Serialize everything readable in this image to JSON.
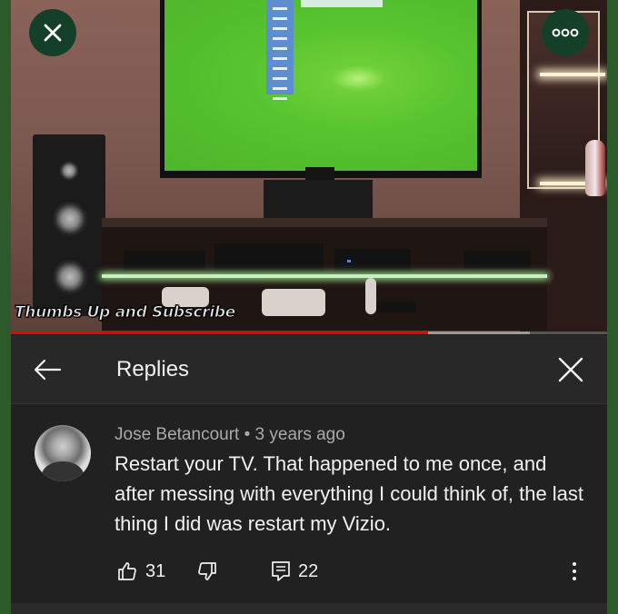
{
  "video": {
    "caption": "Thumbs Up and Subscribe",
    "progress_percent": 70,
    "buffer_percent": 87
  },
  "header": {
    "title": "Replies"
  },
  "comment": {
    "author": "Jose Betancourt",
    "separator": "•",
    "age": "3 years ago",
    "text": "Restart your TV. That happened to me once, and after messing with everything I could think of, the last thing I did was restart my Vizio.",
    "likes": "31",
    "replies": "22"
  },
  "icons": {
    "close_video": "close-icon",
    "more": "more-dots-icon",
    "back": "arrow-left-icon",
    "close_panel": "close-icon",
    "like": "thumbs-up-icon",
    "dislike": "thumbs-down-icon",
    "reply": "reply-comment-icon",
    "overflow": "vertical-dots-icon"
  },
  "colors": {
    "progress": "#ee0000",
    "panel_bg": "#212121",
    "header_bg": "#282828",
    "text_primary": "#f1f1f1",
    "text_secondary": "#aaaaaa"
  }
}
